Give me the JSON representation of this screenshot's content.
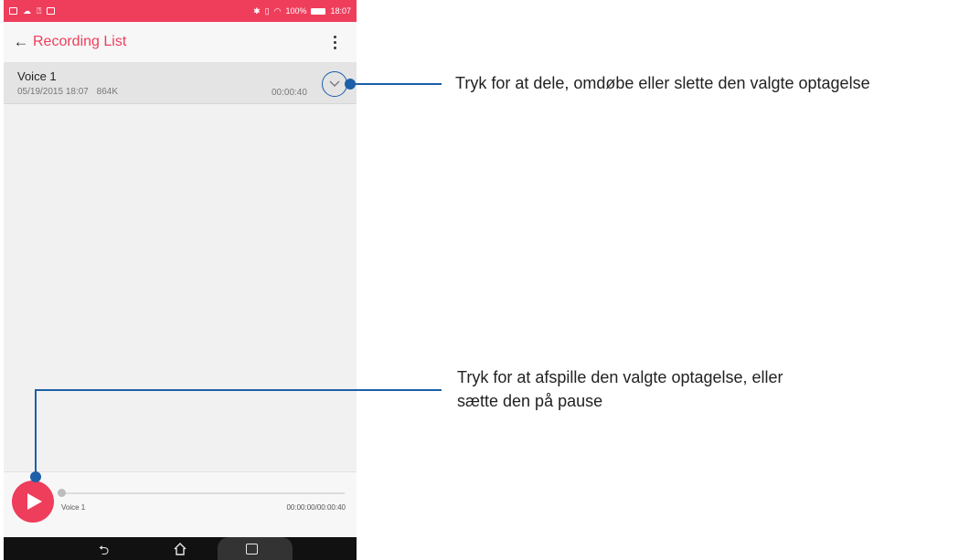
{
  "status_bar": {
    "battery_text": "100%",
    "time": "18:07"
  },
  "app_bar": {
    "back_icon": "arrow-left-icon",
    "title": "Recording List",
    "menu_icon": "more-vertical-icon"
  },
  "recordings": [
    {
      "name": "Voice 1",
      "date": "05/19/2015 18:07",
      "size": "864K",
      "duration": "00:00:40"
    }
  ],
  "player": {
    "track_name": "Voice 1",
    "time": "00:00:00/00:00:40",
    "progress": 0
  },
  "callouts": {
    "expand": "Tryk for at dele, omdøbe eller slette den valgte optagelse",
    "play_line1": "Tryk for at afspille den valgte optagelse, eller",
    "play_line2": "sætte den på pause"
  },
  "colors": {
    "accent": "#ef3d5c",
    "callout": "#1d5fa8"
  }
}
